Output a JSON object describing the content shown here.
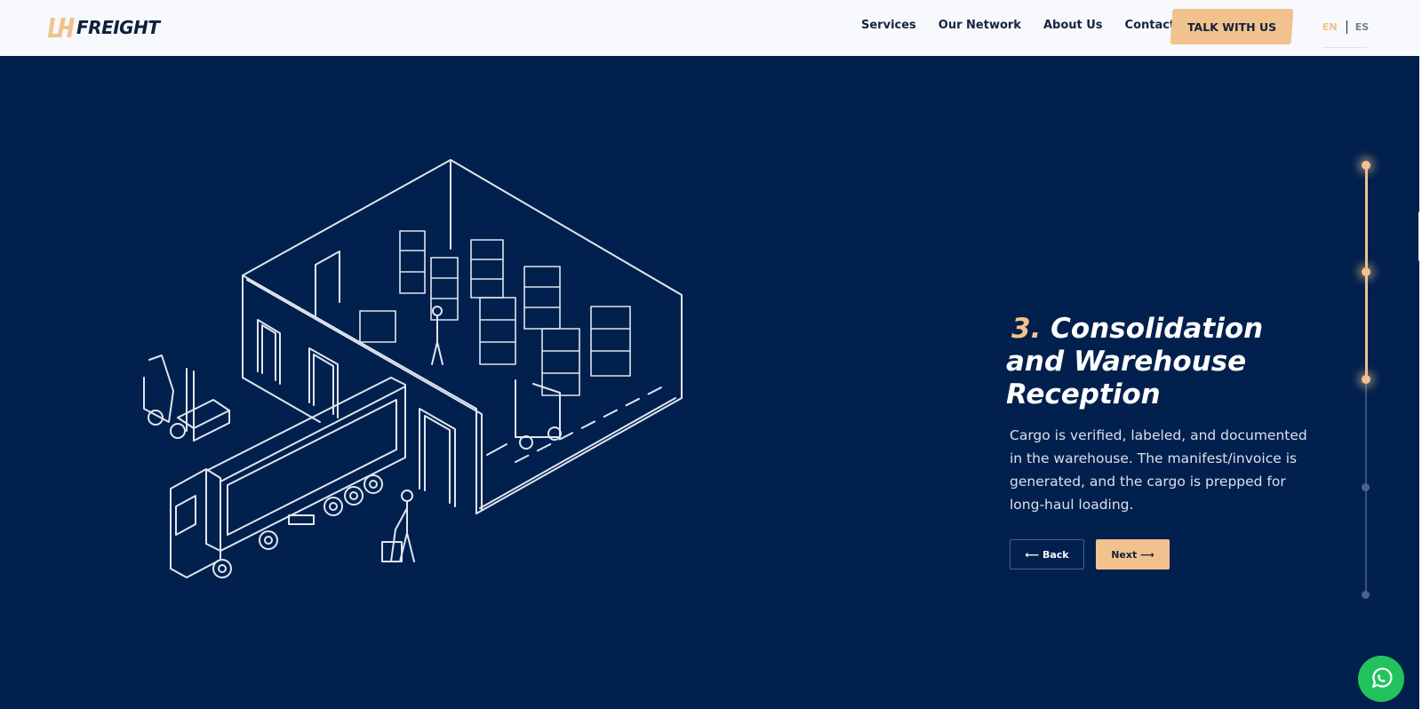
{
  "header": {
    "logo_text": "FREIGHT",
    "nav": [
      "Services",
      "Our Network",
      "About Us",
      "Contact"
    ],
    "cta_label": "TALK WITH US",
    "lang_active": "EN",
    "lang_other": "ES"
  },
  "step": {
    "number": "3.",
    "title": "Consolidation and Warehouse Reception",
    "description": "Cargo is verified, labeled, and documented in the warehouse. The manifest/invoice is generated, and the cargo is prepped for long-haul loading.",
    "back_label": "⟵ Back",
    "next_label": "Next ⟶"
  },
  "progress": {
    "current_step": 3,
    "total_steps": 5
  },
  "colors": {
    "background": "#01204d",
    "accent": "#f1c28d",
    "header": "#f7f9fc",
    "whatsapp": "#22c35e"
  },
  "icons": [
    "logo-mark-icon",
    "whatsapp-icon",
    "warehouse-illustration"
  ]
}
